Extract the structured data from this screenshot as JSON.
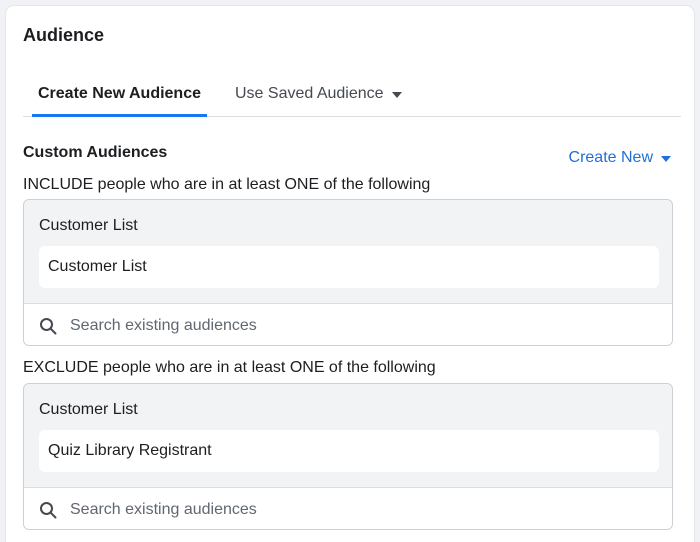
{
  "section": {
    "title": "Audience"
  },
  "tabs": [
    {
      "label": "Create New Audience",
      "active": true
    },
    {
      "label": "Use Saved Audience",
      "active": false
    }
  ],
  "custom_audiences": {
    "title": "Custom Audiences",
    "create_new_label": "Create New",
    "include": {
      "label": "INCLUDE people who are in at least ONE of the following",
      "group_title": "Customer List",
      "selected": "Customer List",
      "search_placeholder": "Search existing audiences"
    },
    "exclude": {
      "label": "EXCLUDE people who are in at least ONE of the following",
      "group_title": "Customer List",
      "selected": "Quiz Library Registrant",
      "search_placeholder": "Search existing audiences"
    }
  },
  "colors": {
    "accent": "#1877f2",
    "link": "#216fdb",
    "box_background": "#f2f3f5"
  }
}
